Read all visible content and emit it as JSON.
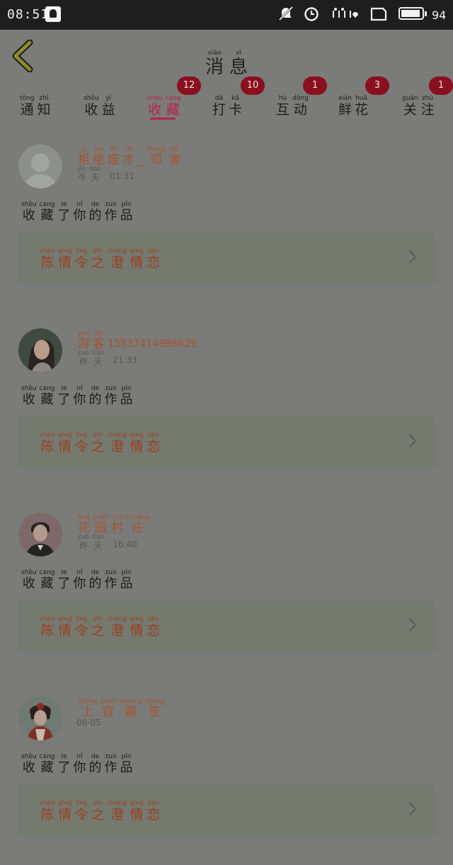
{
  "status": {
    "time": "08:51",
    "battery_pct": "94",
    "battery_level": 0.94
  },
  "header": {
    "back_icon": "chevron-left-icon",
    "title": [
      {
        "py": "xiāo",
        "hz": "消"
      },
      {
        "py": "xī",
        "hz": "息"
      }
    ]
  },
  "tabs": [
    {
      "label": [
        {
          "py": "tōng",
          "hz": "通"
        },
        {
          "py": "zhī",
          "hz": "知"
        }
      ],
      "badge": ""
    },
    {
      "label": [
        {
          "py": "shōu",
          "hz": "收"
        },
        {
          "py": "yì",
          "hz": "益"
        }
      ],
      "badge": ""
    },
    {
      "label": [
        {
          "py": "shōu",
          "hz": "收"
        },
        {
          "py": "cáng",
          "hz": "藏"
        }
      ],
      "badge": "12",
      "active": true
    },
    {
      "label": [
        {
          "py": "dǎ",
          "hz": "打"
        },
        {
          "py": "kǎ",
          "hz": "卡"
        }
      ],
      "badge": "10"
    },
    {
      "label": [
        {
          "py": "hù",
          "hz": "互"
        },
        {
          "py": "dòng",
          "hz": "动"
        }
      ],
      "badge": "1"
    },
    {
      "label": [
        {
          "py": "xiān",
          "hz": "鲜"
        },
        {
          "py": "huā",
          "hz": "花"
        }
      ],
      "badge": "3"
    },
    {
      "label": [
        {
          "py": "guān",
          "hz": "关"
        },
        {
          "py": "zhù",
          "hz": "注"
        }
      ],
      "badge": "1"
    }
  ],
  "action_text": [
    {
      "py": "shōu",
      "hz": "收"
    },
    {
      "py": "cáng",
      "hz": "藏"
    },
    {
      "py": "le",
      "hz": "了"
    },
    {
      "py": "nǐ",
      "hz": "你"
    },
    {
      "py": "de",
      "hz": "的"
    },
    {
      "py": "zuò",
      "hz": "作"
    },
    {
      "py": "pǐn",
      "hz": "品"
    }
  ],
  "work_title": [
    {
      "py": "chén",
      "hz": "陈"
    },
    {
      "py": "qíng",
      "hz": "情"
    },
    {
      "py": "lìng",
      "hz": "令"
    },
    {
      "py": "zhī",
      "hz": "之"
    },
    {
      "py": "chéng",
      "hz": "澄"
    },
    {
      "py": "qíng",
      "hz": "情"
    },
    {
      "py": "liàn",
      "hz": "恋"
    }
  ],
  "items": [
    {
      "user": [
        {
          "py": "jù",
          "hz": "拒"
        },
        {
          "py": "jué",
          "hz": "绝"
        },
        {
          "py": "fèi",
          "hz": "废"
        },
        {
          "py": "cái",
          "hz": "才"
        },
        {
          "py": "",
          "hz": "_"
        },
        {
          "py": "zhèng",
          "hz": "郑"
        },
        {
          "py": "bō",
          "hz": "波"
        }
      ],
      "user_suffix": "",
      "day": [
        {
          "py": "jīn",
          "hz": "今"
        },
        {
          "py": "tiān",
          "hz": "天"
        }
      ],
      "time": "01:31",
      "avatar": "default"
    },
    {
      "user": [
        {
          "py": "yóu",
          "hz": "游"
        },
        {
          "py": "kè",
          "hz": "客"
        }
      ],
      "user_suffix": "15837414998629",
      "day": [
        {
          "py": "zuó",
          "hz": "昨"
        },
        {
          "py": "tiān",
          "hz": "天"
        }
      ],
      "time": "21:33",
      "avatar": "woman"
    },
    {
      "user": [
        {
          "py": "huā",
          "hz": "花"
        },
        {
          "py": "yuán",
          "hz": "园"
        },
        {
          "py": "cūn",
          "hz": "村"
        },
        {
          "py": "zhuāng",
          "hz": "庄"
        }
      ],
      "user_suffix": "",
      "day": [
        {
          "py": "zuó",
          "hz": "昨"
        },
        {
          "py": "tiān",
          "hz": "天"
        }
      ],
      "time": "16:40",
      "avatar": "man"
    },
    {
      "user": [
        {
          "py": "shàng",
          "hz": "上"
        },
        {
          "py": "guān",
          "hz": "官"
        },
        {
          "py": "shuāng",
          "hz": "霜"
        },
        {
          "py": "shēng",
          "hz": "笙"
        }
      ],
      "user_suffix": "",
      "day": [],
      "time": "08-05",
      "avatar": "girl"
    }
  ],
  "colors": {
    "accent": "#b62250",
    "badge": "#8a0f1f",
    "username": "#a5532e",
    "work_title": "#9c3e21"
  }
}
